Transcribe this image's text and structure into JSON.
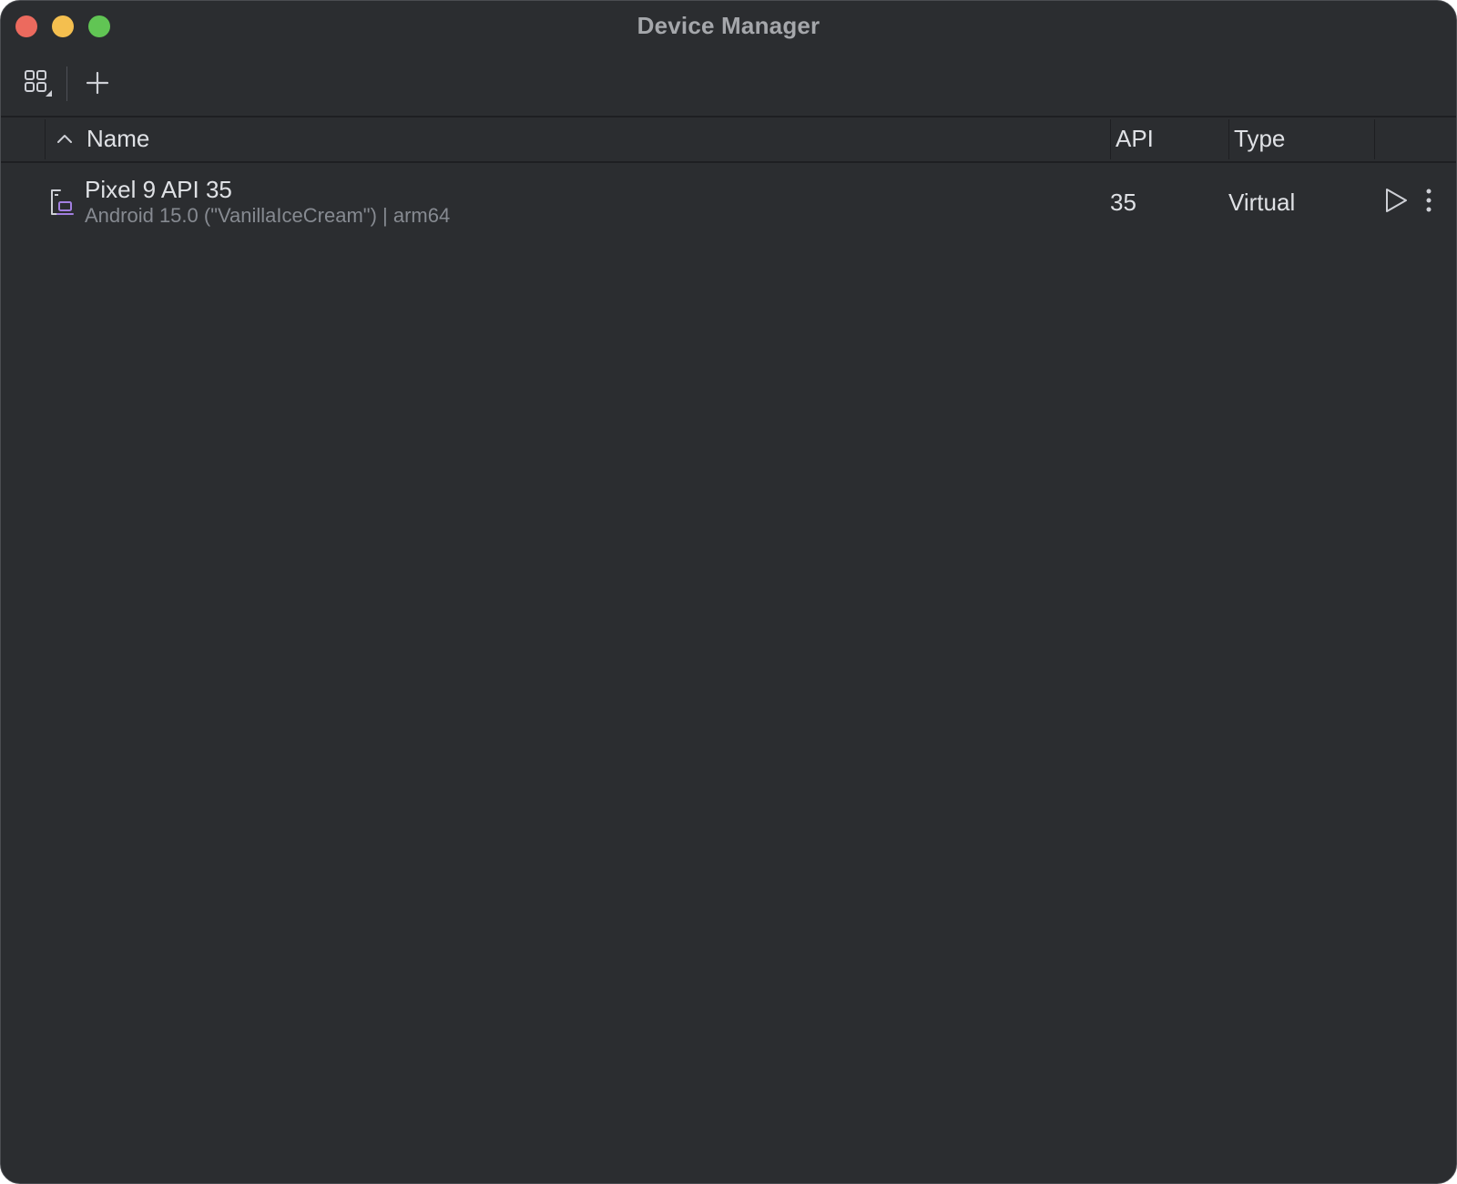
{
  "window": {
    "title": "Device Manager"
  },
  "toolbar": {
    "icons": [
      "grid-view-icon",
      "add-icon"
    ]
  },
  "table": {
    "headers": {
      "name": "Name",
      "api": "API",
      "type": "Type"
    },
    "sort": "ascending",
    "rows": [
      {
        "name": "Pixel 9 API 35",
        "details": "Android 15.0 (\"VanillaIceCream\") | arm64",
        "api": "35",
        "type": "Virtual",
        "icon": "virtual-device-icon"
      }
    ]
  },
  "colors": {
    "background": "#2b2d30",
    "close": "#ec6a5e",
    "minimize": "#f4bf4f",
    "maximize": "#61c554",
    "device_icon_accent": "#a27fe0"
  }
}
